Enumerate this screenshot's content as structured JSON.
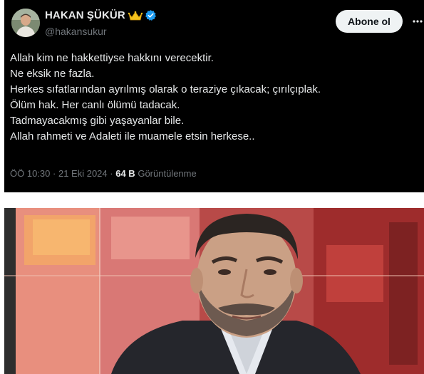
{
  "tweet": {
    "author_name": "HAKAN ŞÜKÜR",
    "handle": "@hakansukur",
    "follow_label": "Abone ol",
    "lines": [
      "Allah kim ne hakkettiyse hakkını verecektir.",
      "Ne eksik ne fazla.",
      "Herkes sıfatlarından ayrılmış olarak o teraziye çıkacak; çırılçıplak.",
      "Ölüm hak. Her canlı ölümü tadacak.",
      "Tadmayacakmış gibi yaşayanlar bile.",
      "Allah rahmeti ve Adaleti ile muamele etsin herkese.."
    ],
    "time": "ÖÖ 10:30",
    "date": "21 Eki 2024",
    "separator": "·",
    "views_count": "64 B",
    "views_label": "Görüntülenme",
    "icons": [
      "crown-icon",
      "verified-badge-icon",
      "more-options-icon"
    ],
    "colors": {
      "background": "#000000",
      "text": "#e7e9ea",
      "secondary": "#71767b",
      "verified": "#1d9bf0",
      "crown": "#f4c21c",
      "button": "#eff3f4"
    }
  },
  "photo": {
    "description_name": "tv-studio-portrait"
  }
}
